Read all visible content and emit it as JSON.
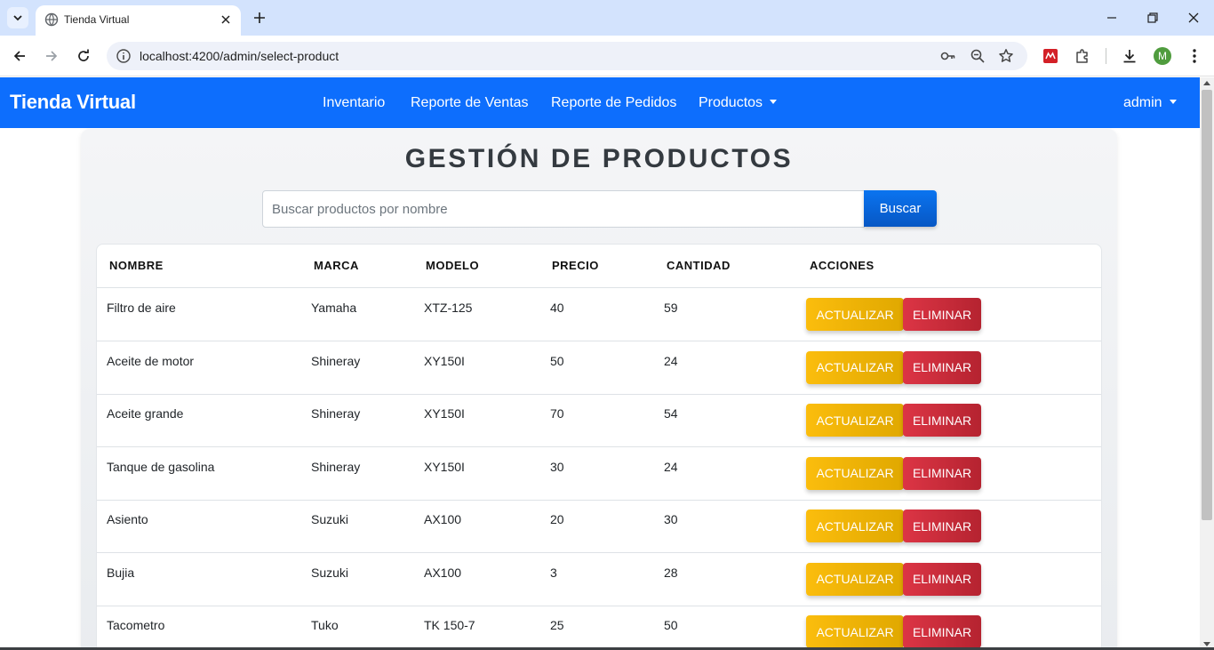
{
  "browser": {
    "tab_title": "Tienda Virtual",
    "url": "localhost:4200/admin/select-product",
    "profile_initial": "M"
  },
  "navbar": {
    "brand": "Tienda Virtual",
    "links": [
      "Inventario",
      "Reporte de Ventas",
      "Reporte de Pedidos",
      "Productos"
    ],
    "user": "admin"
  },
  "page": {
    "title": "GESTIÓN DE PRODUCTOS",
    "search_placeholder": "Buscar productos por nombre",
    "search_button": "Buscar"
  },
  "table": {
    "headers": [
      "NOMBRE",
      "MARCA",
      "MODELO",
      "PRECIO",
      "CANTIDAD",
      "ACCIONES"
    ],
    "rows": [
      {
        "nombre": "Filtro de aire",
        "marca": "Yamaha",
        "modelo": "XTZ-125",
        "precio": "40",
        "cantidad": "59"
      },
      {
        "nombre": "Aceite de motor",
        "marca": "Shineray",
        "modelo": "XY150I",
        "precio": "50",
        "cantidad": "24"
      },
      {
        "nombre": "Aceite grande",
        "marca": "Shineray",
        "modelo": "XY150I",
        "precio": "70",
        "cantidad": "54"
      },
      {
        "nombre": "Tanque de gasolina",
        "marca": "Shineray",
        "modelo": "XY150I",
        "precio": "30",
        "cantidad": "24"
      },
      {
        "nombre": "Asiento",
        "marca": "Suzuki",
        "modelo": "AX100",
        "precio": "20",
        "cantidad": "30"
      },
      {
        "nombre": "Bujia",
        "marca": "Suzuki",
        "modelo": "AX100",
        "precio": "3",
        "cantidad": "28"
      },
      {
        "nombre": "Tacometro",
        "marca": "Tuko",
        "modelo": "TK 150-7",
        "precio": "25",
        "cantidad": "50"
      }
    ],
    "update_label": "ACTUALIZAR",
    "delete_label": "ELIMINAR"
  },
  "colors": {
    "navbar": "#0d6efd",
    "update_button": "#fbbd0d",
    "delete_button": "#dc3545",
    "search_button": "#0a74f0"
  }
}
